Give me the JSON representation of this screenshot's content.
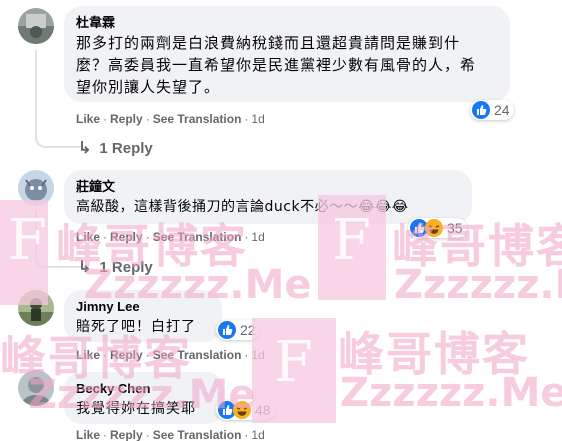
{
  "comments": [
    {
      "name": "杜韋霖",
      "lines": [
        "那多打的兩劑是白浪費納稅錢而且還超貴請問是賺到什",
        "麼？高委員我一直希望你是民進黨裡少數有風骨的人，希",
        "望你別讓人失望了。"
      ],
      "reaction_count": "24",
      "like": "Like",
      "reply": "Reply",
      "see_translation": "See Translation",
      "time": "1d"
    },
    {
      "name": "莊鐘文",
      "lines": [
        "高級酸，這樣背後捅刀的言論duck不必～～😂😂😂"
      ],
      "reaction_count": "35",
      "like": "Like",
      "reply": "Reply",
      "see_translation": "See Translation",
      "time": "1d"
    },
    {
      "name": "Jimny Lee",
      "lines": [
        "賠死了吧！白打了"
      ],
      "reaction_count": "22",
      "like": "Like",
      "reply": "Reply",
      "see_translation": "See Translation",
      "time": "1d"
    },
    {
      "name": "Becky Chen",
      "lines": [
        "我覺得妳在搞笑耶"
      ],
      "reaction_count": "48",
      "like": "Like",
      "reply": "Reply",
      "see_translation": "See Translation",
      "time": "1d"
    }
  ],
  "reply_links": [
    "1 Reply",
    "1 Reply"
  ],
  "watermark": {
    "letter": "F",
    "brand": "峰哥博客",
    "url": "Zzzzzz.Me"
  },
  "colors": {
    "like_blue": "#1877f2",
    "haha_yellow": "#f7b125",
    "bubble_gray": "#f0f2f5",
    "meta_gray": "#65676b"
  }
}
